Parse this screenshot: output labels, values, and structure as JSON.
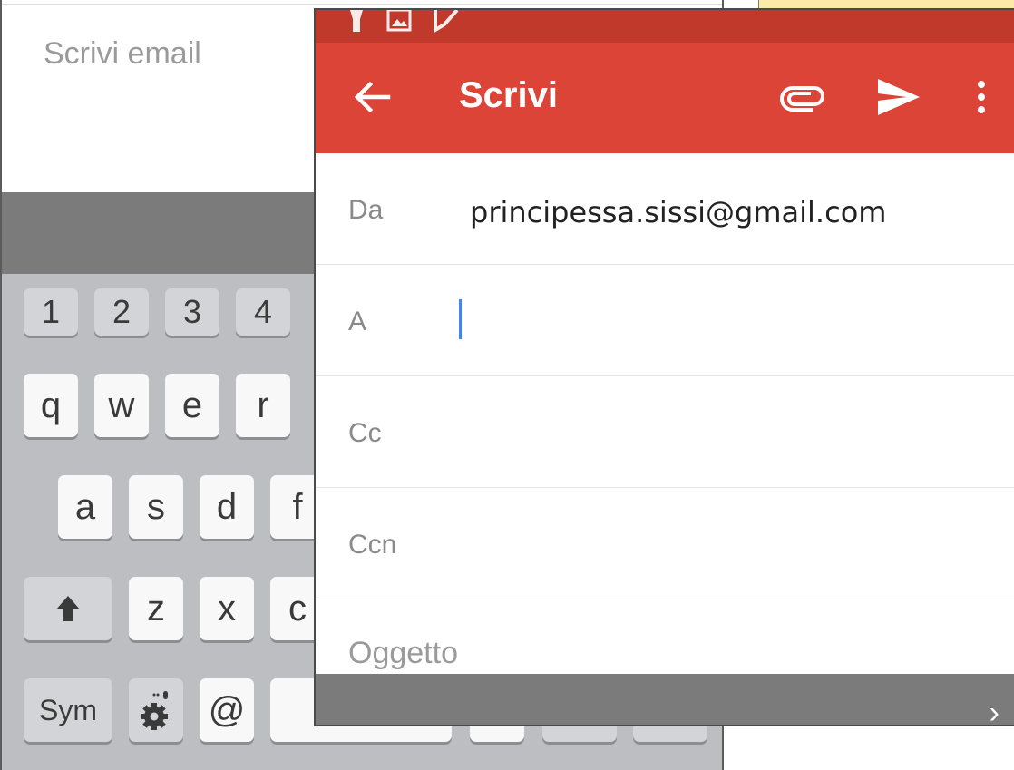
{
  "background_screen": {
    "compose_placeholder": "Scrivi email",
    "keyboard": {
      "number_row": [
        "1",
        "2",
        "3",
        "4"
      ],
      "row1": [
        "q",
        "w",
        "e",
        "r"
      ],
      "row2": [
        "a",
        "s",
        "d",
        "f"
      ],
      "row3": [
        "z",
        "x",
        "c"
      ],
      "sym_label": "Sym",
      "at_label": "@"
    }
  },
  "compose": {
    "title": "Scrivi",
    "fields": {
      "from_label": "Da",
      "from_value": "principessa.sissi@gmail.com",
      "to_label": "A",
      "cc_label": "Cc",
      "bcc_label": "Ccn",
      "subject_placeholder": "Oggetto"
    },
    "icons": {
      "back": "arrow-back-icon",
      "attach": "paperclip-icon",
      "send": "send-icon",
      "more": "more-vert-icon",
      "next": "chevron-right-icon"
    }
  },
  "colors": {
    "app_bar": "#db4437",
    "status_bar": "#c0392b",
    "cursor": "#4285f4",
    "sticky_note": "#fde9a8",
    "keyboard_bg": "#bdbec2"
  }
}
